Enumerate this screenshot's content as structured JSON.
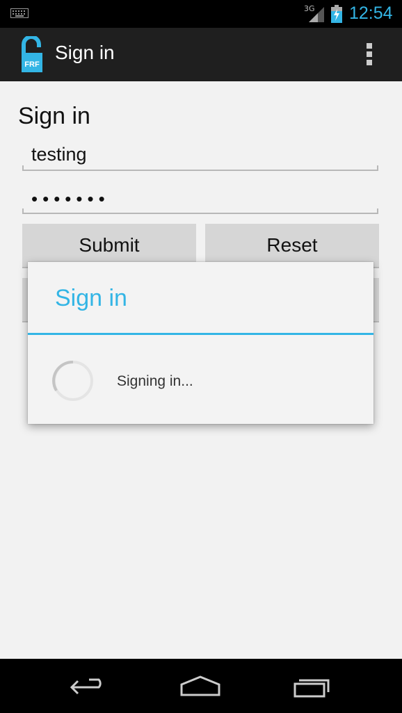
{
  "status_bar": {
    "network": "3G",
    "time": "12:54",
    "icons": [
      "keyboard-icon",
      "signal-icon",
      "battery-charging-icon"
    ]
  },
  "action_bar": {
    "app_icon_text": "FRF",
    "title": "Sign in",
    "overflow_icon": "overflow-menu-icon"
  },
  "form": {
    "heading": "Sign in",
    "username_value": "testing",
    "password_value": "•••••••",
    "submit_label": "Submit",
    "reset_label": "Reset"
  },
  "dialog": {
    "title": "Sign in",
    "message": "Signing in...",
    "spinner_icon": "progress-spinner-icon"
  },
  "nav_bar": {
    "icons": [
      "back-icon",
      "home-icon",
      "recents-icon"
    ]
  },
  "colors": {
    "accent": "#33b5e5",
    "background": "#f2f2f2",
    "action_bar": "#1f1f1f"
  }
}
